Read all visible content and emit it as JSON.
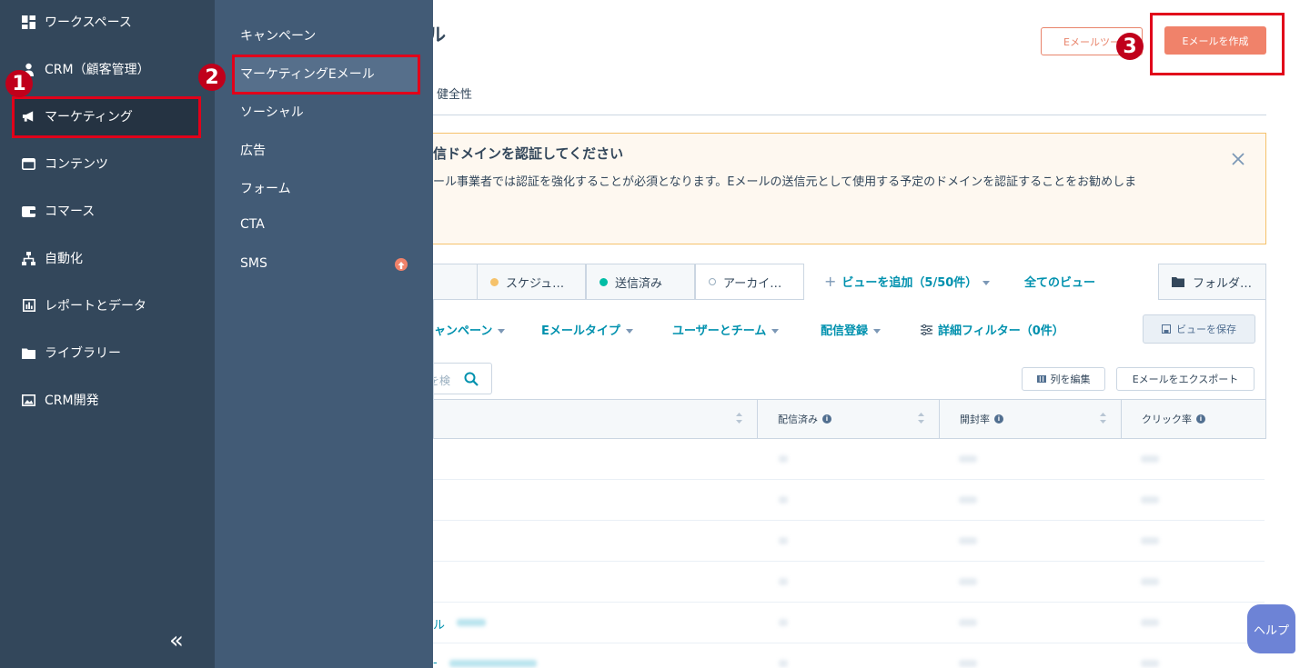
{
  "nav": {
    "items": [
      {
        "label": "ワークスペース",
        "icon": "grid-icon"
      },
      {
        "label": "CRM（顧客管理）",
        "icon": "person-icon"
      },
      {
        "label": "マーケティング",
        "icon": "megaphone-icon"
      },
      {
        "label": "コンテンツ",
        "icon": "browser-icon"
      },
      {
        "label": "コマース",
        "icon": "wallet-icon"
      },
      {
        "label": "自動化",
        "icon": "workflow-icon"
      },
      {
        "label": "レポートとデータ",
        "icon": "bar-chart-icon"
      },
      {
        "label": "ライブラリー",
        "icon": "folder-icon"
      },
      {
        "label": "CRM開発",
        "icon": "image-icon"
      }
    ],
    "collapse_label": "«"
  },
  "subnav": {
    "items": [
      {
        "label": "キャンペーン"
      },
      {
        "label": "マーケティングEメール"
      },
      {
        "label": "ソーシャル"
      },
      {
        "label": "広告"
      },
      {
        "label": "フォーム"
      },
      {
        "label": "CTA"
      },
      {
        "label": "SMS"
      }
    ]
  },
  "header": {
    "title_fragment": "ル",
    "tools_button": "Eメールツー",
    "create_button": "Eメールを作成"
  },
  "tabs": {
    "health": "健全性"
  },
  "alert": {
    "title": "信ドメインを認証してください",
    "body": "ール事業者では認証を強化することが必須となります。Eメールの送信元として使用する予定のドメインを認証することをお勧めしま"
  },
  "views": {
    "tabs": [
      {
        "label": "スケジュ…",
        "dot_color": "#f5c26b"
      },
      {
        "label": "送信済み",
        "dot_color": "#00bda5"
      },
      {
        "label": "アーカイ…",
        "dot_color": "hollow"
      }
    ],
    "add_view": "ビューを追加（5/50件）",
    "all_views": "全てのビュー",
    "folder": "フォルダ…"
  },
  "filters": {
    "campaign": "ャンペーン",
    "email_type": "Eメールタイプ",
    "users_teams": "ユーザーとチーム",
    "subscription": "配信登録",
    "advanced": "詳細フィルター（0件）",
    "save_view": "ビューを保存"
  },
  "toolbar": {
    "search_placeholder": "を検",
    "edit_columns": "列を編集",
    "export": "Eメールをエクスポート"
  },
  "table": {
    "headers": [
      "配信済み",
      "開封率",
      "クリック率"
    ],
    "link_rows": [
      {
        "text": "ル "
      },
      {
        "text": "- "
      }
    ]
  },
  "help": "ヘルプ",
  "annotations": [
    "1",
    "2",
    "3"
  ],
  "colors": {
    "nav_bg": "#33475b",
    "subnav_bg": "#425b76",
    "accent": "#f0826a",
    "link": "#0091ae",
    "annotation_red": "#e1001a"
  }
}
